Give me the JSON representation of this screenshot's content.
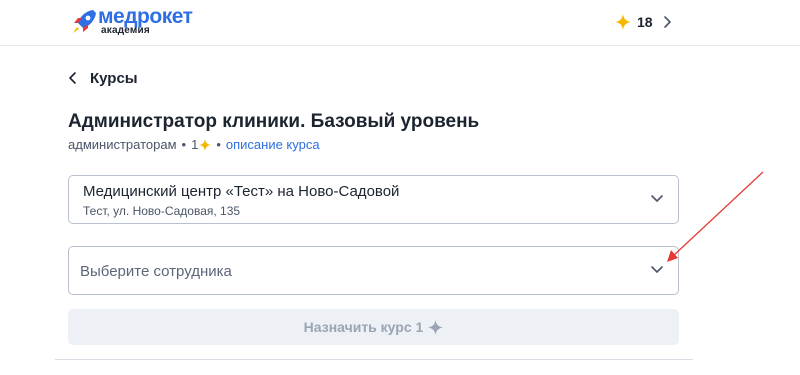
{
  "brand": {
    "name": "медрокет",
    "subtitle": "академия",
    "color": "#2f6fe4"
  },
  "header": {
    "balance_icon": "star-icon",
    "balance": "18",
    "balance_color": "#f5b800"
  },
  "nav": {
    "back_label": "Курсы"
  },
  "course": {
    "title": "Администратор клиники. Базовый уровень",
    "audience": "администраторам",
    "separator": "•",
    "price": "1",
    "description_link": "описание курса"
  },
  "clinic_select": {
    "name": "Медицинский центр «Тест» на Ново-Садовой",
    "address": "Тест, ул. Ново-Садовая, 135"
  },
  "employee_select": {
    "placeholder": "Выберите сотрудника"
  },
  "assign_button": {
    "label": "Назначить курс 1",
    "disabled": true
  },
  "annotation": {
    "color": "#e53935",
    "icon": "red-arrow-annotation"
  }
}
